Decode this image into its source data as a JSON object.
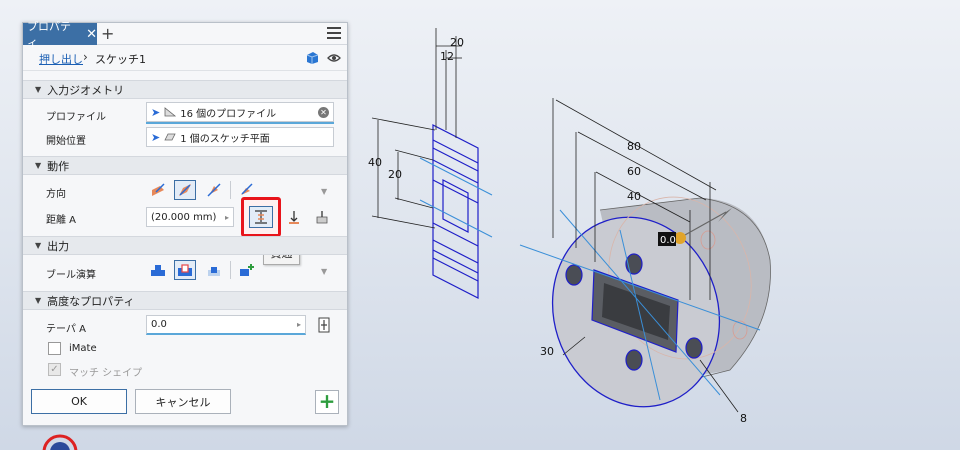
{
  "panel": {
    "tab_label": "プロパティ",
    "tab_close": "✕",
    "tab_add": "+",
    "breadcrumb_link": "押し出し",
    "breadcrumb_sep": "›",
    "breadcrumb_current": "スケッチ1"
  },
  "sections": {
    "input_geometry": "入力ジオメトリ",
    "behavior": "動作",
    "output": "出力",
    "advanced": "高度なプロパティ"
  },
  "fields": {
    "profile_label": "プロファイル",
    "profile_value": "16 個のプロファイル",
    "start_label": "開始位置",
    "start_value": "1 個のスケッチ平面",
    "direction_label": "方向",
    "distance_label": "距離 A",
    "distance_value": "(20.000 mm)",
    "boolean_label": "ブール演算",
    "taper_label": "テーパ A",
    "taper_value": "0.0",
    "imate_label": "iMate",
    "match_shape_label": "マッチ シェイプ"
  },
  "tooltip": "貫通",
  "buttons": {
    "ok": "OK",
    "cancel": "キャンセル"
  },
  "dimensions": {
    "d20": "20",
    "d12": "12",
    "d40_left": "40",
    "d20_left": "20",
    "d80": "80",
    "d60": "60",
    "d40_right": "40",
    "d30": "30",
    "d8": "8",
    "manip_value": "0.0"
  },
  "colors": {
    "accent": "#3c6fa5",
    "highlight": "#e8141b",
    "sketch_line": "#1f1fc8"
  }
}
